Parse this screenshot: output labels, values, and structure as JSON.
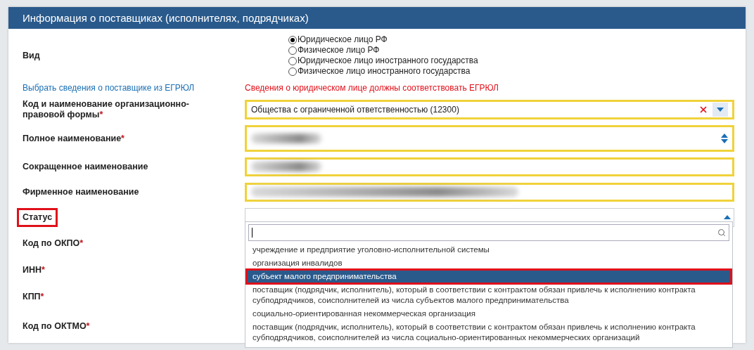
{
  "panel": {
    "title": "Информация о поставщиках (исполнителях, подрядчиках)"
  },
  "type_choice": {
    "label": "Вид",
    "options": [
      {
        "label": "Юридическое лицо РФ",
        "selected": true
      },
      {
        "label": "Физическое лицо РФ",
        "selected": false
      },
      {
        "label": "Юридическое лицо иностранного государства",
        "selected": false
      },
      {
        "label": "Физическое лицо иностранного государства",
        "selected": false
      }
    ]
  },
  "egrul": {
    "link": "Выбрать сведения о поставщике из ЕГРЮЛ",
    "warning": "Сведения о юридическом лице должны соответствовать ЕГРЮЛ"
  },
  "fields": [
    {
      "kind": "select",
      "label": "Код и наименование организационно-правовой формы",
      "required_mark": "*",
      "value": "Общества с ограниченной ответственностью (12300)"
    },
    {
      "kind": "textarea",
      "label": "Полное наименование",
      "required_mark": "*",
      "redacted": true
    },
    {
      "kind": "text",
      "label": "Сокращенное наименование",
      "redacted": true
    },
    {
      "kind": "wide-text",
      "label": "Фирменное наименование",
      "redacted": true
    },
    {
      "kind": "combo",
      "label": "Статус",
      "highlighted": true,
      "expanded": true,
      "options": [
        {
          "label": "учреждение и предприятие уголовно-исполнительной системы",
          "selected": false,
          "highlighted": false
        },
        {
          "label": "организация инвалидов",
          "selected": false,
          "highlighted": false
        },
        {
          "label": "субъект малого предпринимательства",
          "selected": true,
          "highlighted": true
        },
        {
          "label": "поставщик (подрядчик, исполнитель), который в соответствии с контрактом обязан привлечь к исполнению контракта субподрядчиков, соисполнителей из числа субъектов малого предпринимательства",
          "selected": false,
          "highlighted": false
        },
        {
          "label": "социально-ориентированная некоммерческая организация",
          "selected": false,
          "highlighted": false
        },
        {
          "label": "поставщик (подрядчик, исполнитель), который в соответствии с контрактом обязан привлечь к исполнению контракта субподрядчиков, соисполнителей из числа социально-ориентированных некоммерческих организаций",
          "selected": false,
          "highlighted": false
        }
      ]
    },
    {
      "kind": "covered",
      "label": "Код по ОКПО",
      "required_mark": "*"
    },
    {
      "kind": "covered",
      "label": "ИНН",
      "required_mark": "*"
    },
    {
      "kind": "covered",
      "label": "КПП",
      "required_mark": "*"
    },
    {
      "kind": "covered",
      "label": "Код по ОКТМО",
      "required_mark": "*"
    }
  ]
}
